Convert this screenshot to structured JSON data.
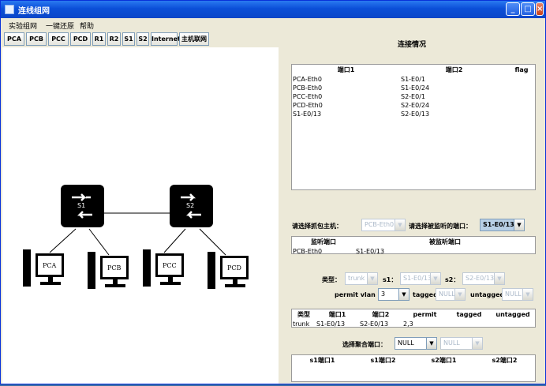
{
  "window": {
    "title": "连线组网"
  },
  "menu": [
    "实验组网",
    "一键还原",
    "帮助"
  ],
  "toolbar": [
    "PCA",
    "PCB",
    "PCC",
    "PCD",
    "R1",
    "R2",
    "S1",
    "S2",
    "Internet",
    "主机联网"
  ],
  "topology": {
    "switches": [
      "S1",
      "S2"
    ],
    "pcs": [
      "PCA",
      "PCB",
      "PCC",
      "PCD"
    ]
  },
  "connections": {
    "title": "连接情况",
    "headers": [
      "端口1",
      "端口2",
      "flag"
    ],
    "rows": [
      [
        "PCA-Eth0",
        "S1-E0/1",
        ""
      ],
      [
        "PCB-Eth0",
        "S1-E0/24",
        ""
      ],
      [
        "PCC-Eth0",
        "S2-E0/1",
        ""
      ],
      [
        "PCD-Eth0",
        "S2-E0/24",
        ""
      ],
      [
        "S1-E0/13",
        "S2-E0/13",
        ""
      ]
    ],
    "selected_row": 4
  },
  "capture": {
    "host_label": "请选择抓包主机：",
    "host_value": "PCB-Eth0",
    "port_label": "请选择被监听的端口：",
    "port_value": "S1-E0/13",
    "headers": [
      "监听端口",
      "被监听端口"
    ],
    "row": [
      "PCB-Eth0",
      "S1-E0/13"
    ]
  },
  "vlan": {
    "type_label": "类型：",
    "type_value": "trunk",
    "s1_label": "s1：",
    "s1_value": "S1-E0/13",
    "s2_label": "s2：",
    "s2_value": "S2-E0/13",
    "permit_label": "permit vlan id",
    "permit_value": "3",
    "tagged_label": "tagged",
    "tagged_value": "NULL",
    "untagged_label": "untagged",
    "untagged_value": "NULL",
    "headers": [
      "类型",
      "端口1",
      "端口2",
      "permit",
      "tagged",
      "untagged"
    ],
    "row": [
      "trunk",
      "S1-E0/13",
      "S2-E0/13",
      "2,3",
      "",
      ""
    ]
  },
  "aggregate": {
    "label": "选择聚合端口：",
    "value1": "NULL",
    "value2": "NULL",
    "headers": [
      "s1端口1",
      "s1端口2",
      "s2端口1",
      "s2端口2"
    ]
  }
}
